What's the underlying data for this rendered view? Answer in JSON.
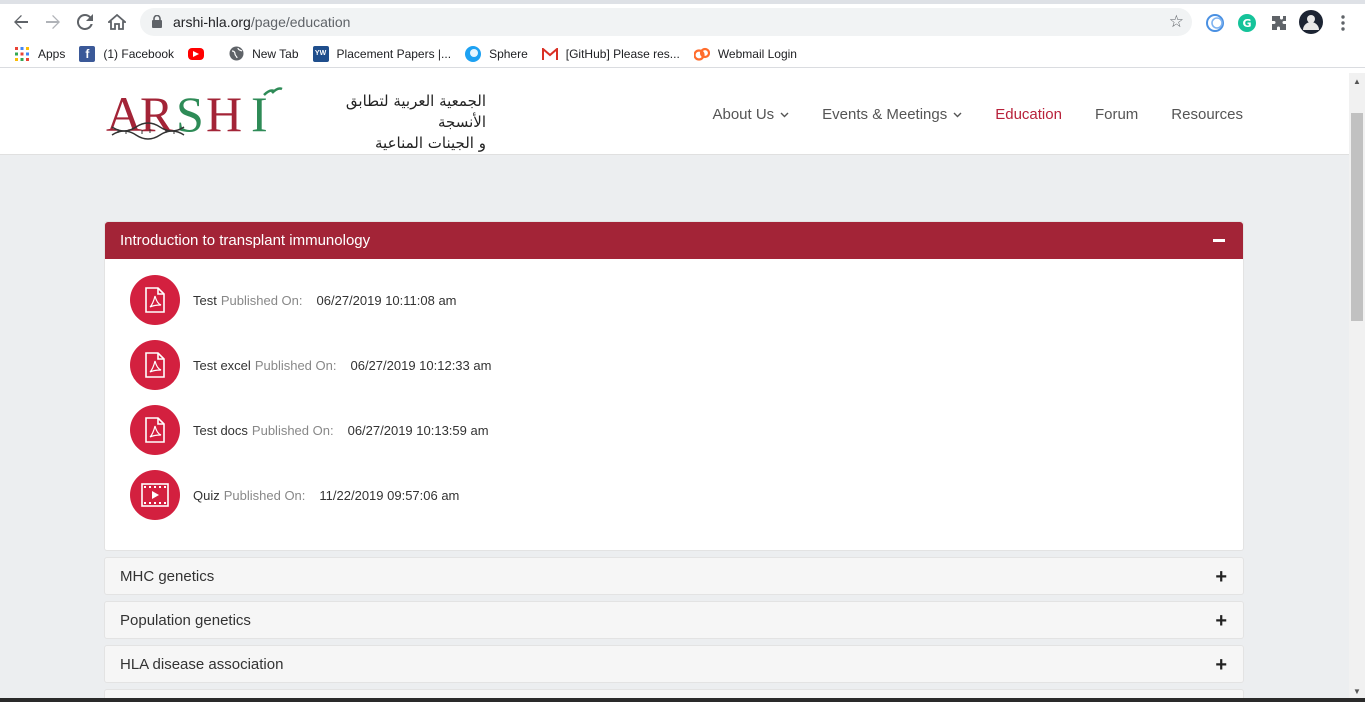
{
  "browser": {
    "url_host": "arshi-hla.org",
    "url_path": "/page/education",
    "bookmarks": [
      {
        "label": "Apps",
        "icon": "apps-grid-icon"
      },
      {
        "label": "(1) Facebook",
        "icon": "facebook-icon"
      },
      {
        "label": "",
        "icon": "youtube-icon"
      },
      {
        "label": "New Tab",
        "icon": "globe-icon"
      },
      {
        "label": "Placement Papers |...",
        "icon": "yw-icon"
      },
      {
        "label": "Sphere",
        "icon": "sphere-icon"
      },
      {
        "label": "[GitHub] Please res...",
        "icon": "gmail-icon"
      },
      {
        "label": "Webmail Login",
        "icon": "cpanel-icon"
      }
    ]
  },
  "site": {
    "logo_text": "ARSHI",
    "logo_arabic_line1": "الجمعية العربية لتطابق الأنسجة",
    "logo_arabic_line2": "و الجينات المناعية",
    "nav": [
      {
        "label": "About Us",
        "has_dropdown": true,
        "active": false
      },
      {
        "label": "Events & Meetings",
        "has_dropdown": true,
        "active": false
      },
      {
        "label": "Education",
        "has_dropdown": false,
        "active": true
      },
      {
        "label": "Forum",
        "has_dropdown": false,
        "active": false
      },
      {
        "label": "Resources",
        "has_dropdown": false,
        "active": false
      }
    ],
    "accent_color": "#a32437"
  },
  "accordion": {
    "open_panel": {
      "title": "Introduction to transplant immunology",
      "items": [
        {
          "name": "Test",
          "published_label": "Published On:",
          "date": "06/27/2019 10:11:08 am",
          "icon": "pdf-icon"
        },
        {
          "name": "Test excel",
          "published_label": "Published On:",
          "date": "06/27/2019 10:12:33 am",
          "icon": "pdf-icon"
        },
        {
          "name": "Test docs",
          "published_label": "Published On:",
          "date": "06/27/2019 10:13:59 am",
          "icon": "pdf-icon"
        },
        {
          "name": "Quiz",
          "published_label": "Published On:",
          "date": "11/22/2019 09:57:06 am",
          "icon": "video-icon"
        }
      ]
    },
    "closed_panels": [
      {
        "title": "MHC genetics"
      },
      {
        "title": "Population genetics"
      },
      {
        "title": "HLA disease association"
      }
    ]
  }
}
